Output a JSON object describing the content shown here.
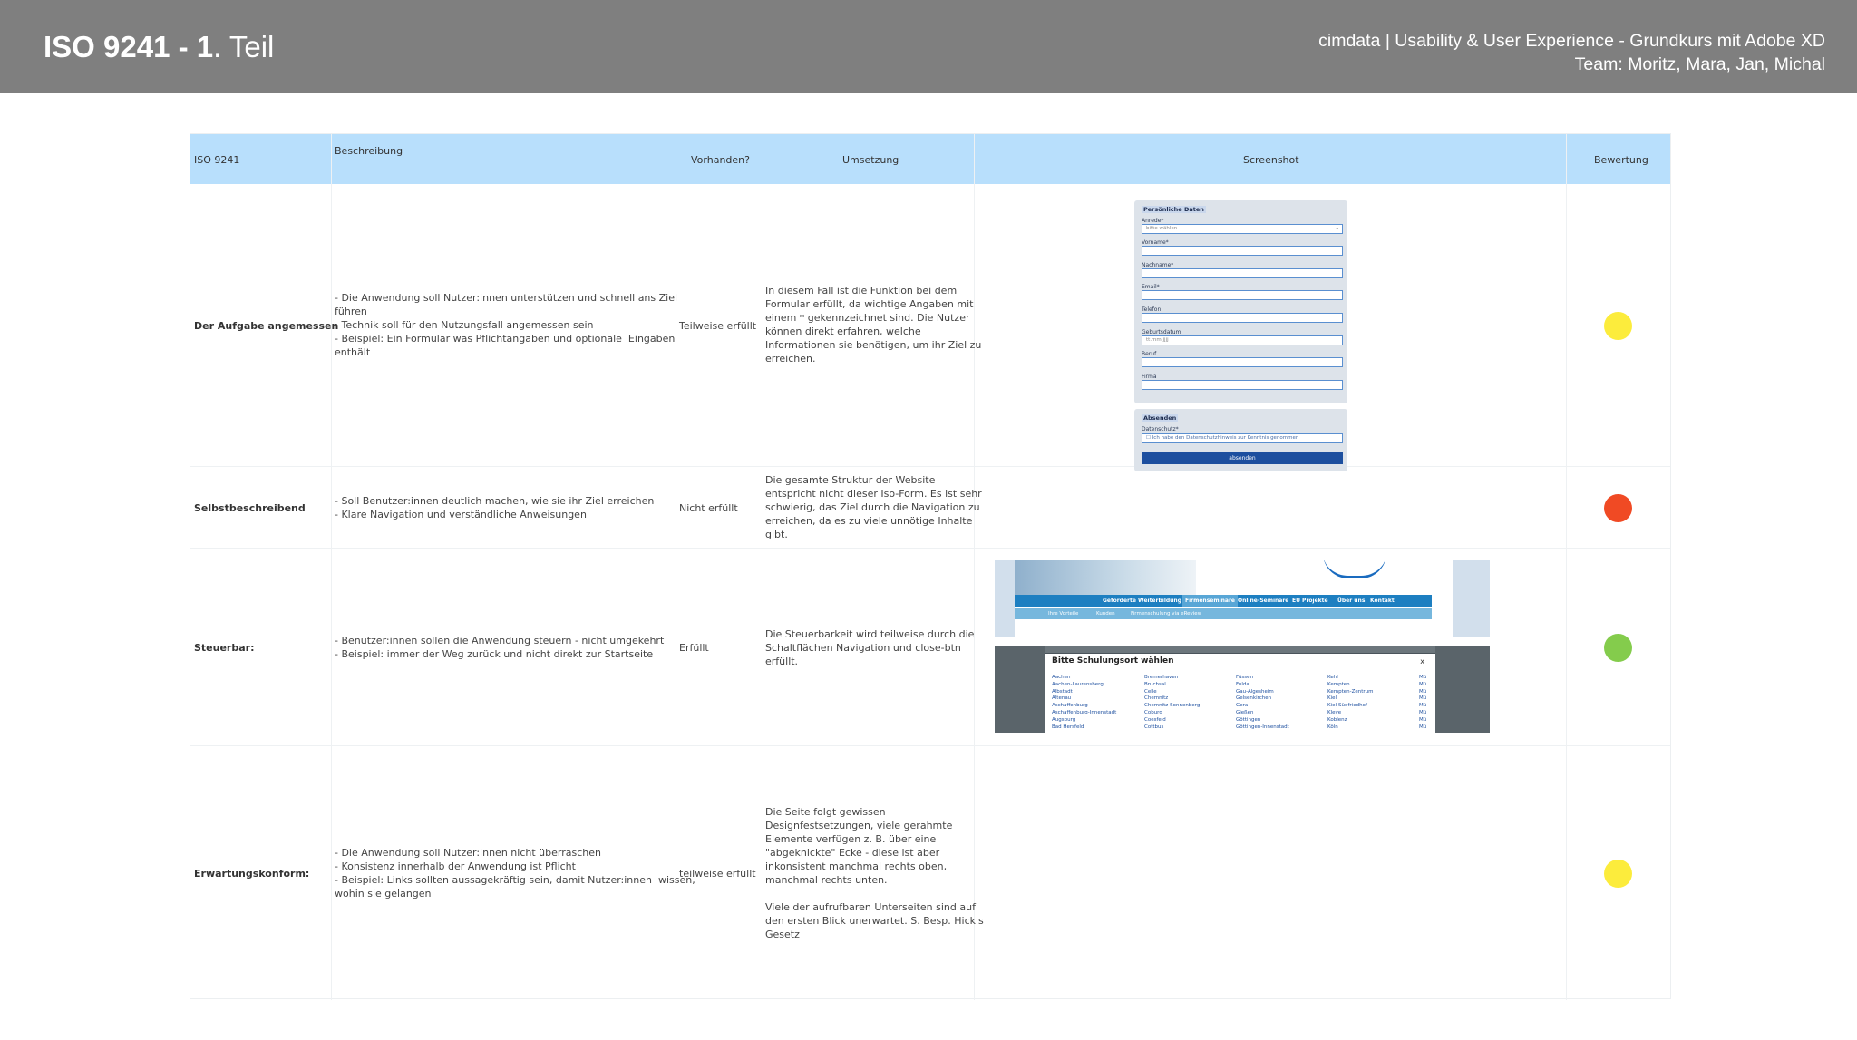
{
  "header": {
    "title_bold": "ISO 9241 - 1",
    "title_rest": ". Teil",
    "course": "cimdata | Usability & User Experience - Grundkurs mit Adobe XD",
    "team": "Team: Moritz, Mara, Jan, Michal"
  },
  "table": {
    "columns": [
      "ISO 9241",
      "Beschreibung",
      "Vorhanden?",
      "Umsetzung",
      "Screenshot",
      "Bewertung"
    ],
    "rows": [
      {
        "name": "Der Aufgabe angemessen",
        "description": [
          "- Die Anwendung soll Nutzer:innen unterstützen und schnell ans Ziel",
          "führen",
          "- Technik soll für den Nutzungsfall angemessen sein",
          "- Beispiel: Ein Formular was Pflichtangaben und optionale  Eingaben",
          "enthält"
        ],
        "status": "Teilweise erfüllt",
        "implementation": [
          "In diesem Fall ist die Funktion bei dem",
          "Formular erfüllt, da wichtige Angaben mit",
          "einem * gekennzeichnet sind. Die Nutzer",
          "können direkt erfahren, welche",
          "Informationen sie benötigen, um ihr Ziel zu",
          "erreichen."
        ],
        "rating_color": "#fcec3c"
      },
      {
        "name": "Selbstbeschreibend",
        "description": [
          "- Soll Benutzer:innen deutlich machen, wie sie ihr Ziel erreichen",
          "- Klare Navigation und verständliche Anweisungen"
        ],
        "status": "Nicht erfüllt",
        "implementation": [
          "Die gesamte Struktur der Website",
          "entspricht nicht dieser Iso-Form. Es ist sehr",
          "schwierig, das Ziel durch die Navigation zu",
          "erreichen, da es zu viele unnötige Inhalte",
          "gibt."
        ],
        "rating_color": "#f04a24"
      },
      {
        "name": "Steuerbar:",
        "description": [
          "- Benutzer:innen sollen die Anwendung steuern - nicht umgekehrt",
          "- Beispiel: immer der Weg zurück und nicht direkt zur Startseite"
        ],
        "status": "Erfüllt",
        "implementation": [
          "Die Steuerbarkeit wird teilweise durch die",
          "Schaltflächen Navigation und close-btn",
          "erfüllt."
        ],
        "rating_color": "#84cc4c"
      },
      {
        "name": "Erwartungskonform:",
        "description": [
          "- Die Anwendung soll Nutzer:innen nicht überraschen",
          "- Konsistenz innerhalb der Anwendung ist Pflicht",
          "- Beispiel: Links sollten aussagekräftig sein, damit Nutzer:innen  wissen,",
          "wohin sie gelangen"
        ],
        "status": "teilweise erfüllt",
        "implementation": [
          "Die Seite folgt gewissen",
          "Designfestsetzungen, viele gerahmte",
          "Elemente verfügen z. B. über eine",
          "\"abgeknickte\" Ecke - diese ist aber",
          "inkonsistent manchmal rechts oben,",
          "manchmal rechts unten.",
          "",
          "Viele der aufrufbaren Unterseiten sind auf",
          "den ersten Blick unerwartet. S. Besp. Hick's",
          "Gesetz"
        ],
        "rating_color": "#fcec3c"
      }
    ]
  },
  "screenshot_form": {
    "section_personal": "Persönliche Daten",
    "fields": [
      {
        "label": "Anrede*",
        "value": "bitte wählen"
      },
      {
        "label": "Vorname*",
        "value": ""
      },
      {
        "label": "Nachname*",
        "value": ""
      },
      {
        "label": "Email*",
        "value": ""
      },
      {
        "label": "Telefon",
        "value": ""
      },
      {
        "label": "Geburtsdatum",
        "value": "tt.mm.jjjj"
      },
      {
        "label": "Beruf",
        "value": ""
      },
      {
        "label": "Firma",
        "value": ""
      }
    ],
    "section_submit": "Absenden",
    "privacy_label": "Datenschutz*",
    "privacy_text": "Ich habe den Datenschutzhinweis zur Kenntnis genommen",
    "submit_label": "absenden"
  },
  "screenshot_nav": {
    "items": [
      "Geförderte Weiterbildung",
      "Firmenseminare",
      "Online-Seminare",
      "EU Projekte",
      "Über uns",
      "Kontakt"
    ],
    "subitems": [
      "Ihre Vorteile",
      "Kunden",
      "Firmenschulung via eReview"
    ]
  },
  "screenshot_modal": {
    "title": "Bitte Schulungsort wählen",
    "close": "x",
    "columns": [
      [
        "Aachen",
        "Aachen-Laurensberg",
        "Albstadt",
        "Altenau",
        "Aschaffenburg",
        "Aschaffenburg-Innenstadt",
        "Augsburg",
        "Bad Hersfeld"
      ],
      [
        "Bremerhaven",
        "Bruchsal",
        "Celle",
        "Chemnitz",
        "Chemnitz-Sonnenberg",
        "Coburg",
        "Coesfeld",
        "Cottbus"
      ],
      [
        "Füssen",
        "Fulda",
        "Gau-Algesheim",
        "Gelsenkirchen",
        "Gera",
        "Gießen",
        "Göttingen",
        "Göttingen-Innenstadt"
      ],
      [
        "Kehl",
        "Kempten",
        "Kempten-Zentrum",
        "Kiel",
        "Kiel-Südfriedhof",
        "Kleve",
        "Koblenz",
        "Köln"
      ],
      [
        "Mü",
        "Mü",
        "Mü",
        "Mü",
        "Mü",
        "Mü",
        "Mü",
        "Mü"
      ]
    ]
  }
}
